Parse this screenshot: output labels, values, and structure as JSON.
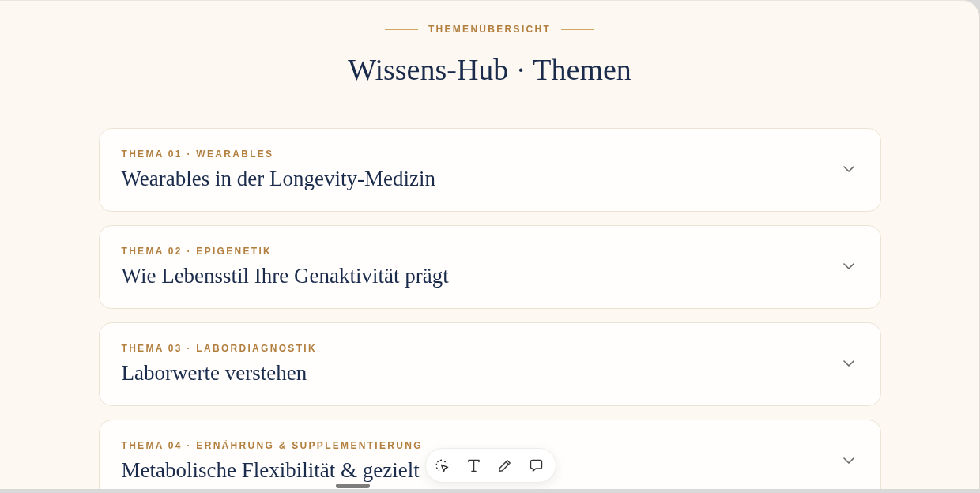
{
  "header": {
    "eyebrow": "THEMENÜBERSICHT",
    "title": "Wissens-Hub · Themen"
  },
  "topics": [
    {
      "label": "THEMA 01 · WEARABLES",
      "title": "Wearables in der Longevity-Medizin",
      "expanded": false
    },
    {
      "label": "THEMA 02 · EPIGENETIK",
      "title": "Wie Lebensstil Ihre Genaktivität prägt",
      "expanded": false
    },
    {
      "label": "THEMA 03 · LABORDIAGNOSTIK",
      "title": "Laborwerte verstehen",
      "expanded": false
    },
    {
      "label": "THEMA 04 · ERNÄHRUNG & SUPPLEMENTIERUNG",
      "title": "Metabolische Flexibilität & gezielt",
      "expanded": false
    }
  ]
}
